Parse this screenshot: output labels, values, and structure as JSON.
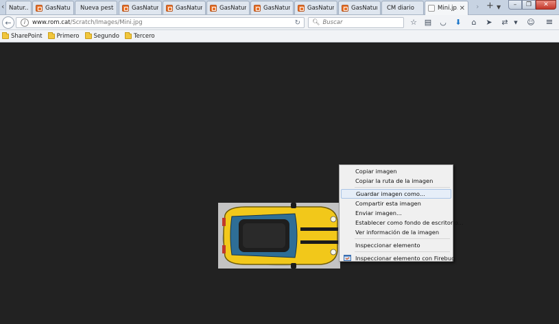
{
  "tabs": [
    {
      "label": "Natur...",
      "icon": "tab-favicon"
    },
    {
      "label": "GasNatur...",
      "icon": "tab-favicon"
    },
    {
      "label": "Nueva pestaña",
      "icon": ""
    },
    {
      "label": "GasNatur...",
      "icon": "tab-favicon"
    },
    {
      "label": "GasNatur...",
      "icon": "tab-favicon"
    },
    {
      "label": "GasNatur...",
      "icon": "tab-favicon"
    },
    {
      "label": "GasNatur...",
      "icon": "tab-favicon"
    },
    {
      "label": "GasNatur...",
      "icon": "tab-favicon"
    },
    {
      "label": "GasNatur...",
      "icon": "tab-favicon"
    },
    {
      "label": "CM diario",
      "icon": ""
    },
    {
      "label": "Mini.jp...",
      "icon": "page-favicon",
      "active": true
    }
  ],
  "nav": {
    "url_host": "www.rom.cat",
    "url_path": "/Scratch/Images/Mini.jpg",
    "search_placeholder": "Buscar"
  },
  "bookmarks": [
    {
      "label": "SharePoint"
    },
    {
      "label": "Primero"
    },
    {
      "label": "Segundo"
    },
    {
      "label": "Tercero"
    }
  ],
  "context_menu": {
    "items": [
      {
        "label": "Copiar imagen"
      },
      {
        "label": "Copiar la ruta de la imagen"
      },
      {
        "label": "Guardar imagen como..."
      },
      {
        "label": "Compartir esta imagen"
      },
      {
        "label": "Enviar imagen..."
      },
      {
        "label": "Establecer como fondo de escritorio..."
      },
      {
        "label": "Ver información de la imagen"
      },
      {
        "label": "Inspeccionar elemento"
      },
      {
        "label": "Inspeccionar elemento con Firebug"
      }
    ]
  },
  "colors": {
    "page_background": "#222222",
    "car_body": "#f2c81a",
    "car_window": "#2e6e96"
  }
}
